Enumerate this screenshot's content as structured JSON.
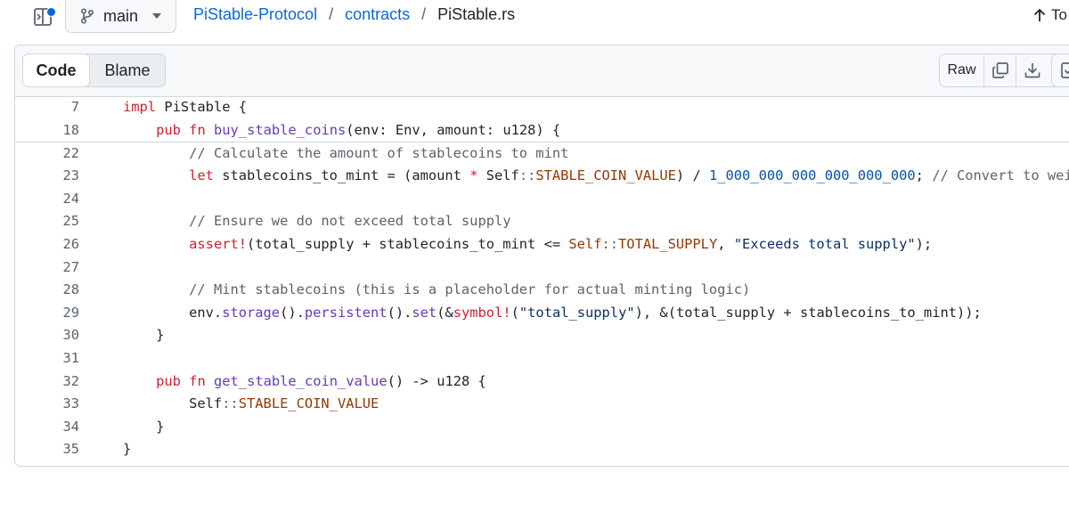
{
  "header": {
    "branch_label": "main",
    "breadcrumb": {
      "repo": "PiStable-Protocol",
      "separator": "/",
      "dir": "contracts",
      "file": "PiStable.rs"
    },
    "top_link_label": "To"
  },
  "toolbar": {
    "tabs": [
      {
        "label": "Code",
        "active": true
      },
      {
        "label": "Blame",
        "active": false
      }
    ],
    "raw_label": "Raw",
    "icons": [
      "copy-icon",
      "download-icon",
      "checklist-icon"
    ]
  },
  "colors": {
    "accent": "#0969da",
    "keyword": "#cf222e",
    "function": "#6639ba",
    "comment": "#59636e",
    "constant": "#953800",
    "number": "#0550ae",
    "string": "#0a3069"
  },
  "code_lines": [
    {
      "num": "7",
      "text": "impl PiStable {"
    },
    {
      "num": "18",
      "text": "    pub fn buy_stable_coins(env: Env, amount: u128) {"
    },
    {
      "num": "22",
      "text": "        // Calculate the amount of stablecoins to mint"
    },
    {
      "num": "23",
      "text": "        let stablecoins_to_mint = (amount * Self::STABLE_COIN_VALUE) / 1_000_000_000_000_000_000; // Convert to wei"
    },
    {
      "num": "24",
      "text": ""
    },
    {
      "num": "25",
      "text": "        // Ensure we do not exceed total supply"
    },
    {
      "num": "26",
      "text": "        assert!(total_supply + stablecoins_to_mint <= Self::TOTAL_SUPPLY, \"Exceeds total supply\");"
    },
    {
      "num": "27",
      "text": ""
    },
    {
      "num": "28",
      "text": "        // Mint stablecoins (this is a placeholder for actual minting logic)"
    },
    {
      "num": "29",
      "text": "        env.storage().persistent().set(&symbol!(\"total_supply\"), &(total_supply + stablecoins_to_mint));"
    },
    {
      "num": "30",
      "text": "    }"
    },
    {
      "num": "31",
      "text": ""
    },
    {
      "num": "32",
      "text": "    pub fn get_stable_coin_value() -> u128 {"
    },
    {
      "num": "33",
      "text": "        Self::STABLE_COIN_VALUE"
    },
    {
      "num": "34",
      "text": "    }"
    },
    {
      "num": "35",
      "text": "}"
    }
  ]
}
